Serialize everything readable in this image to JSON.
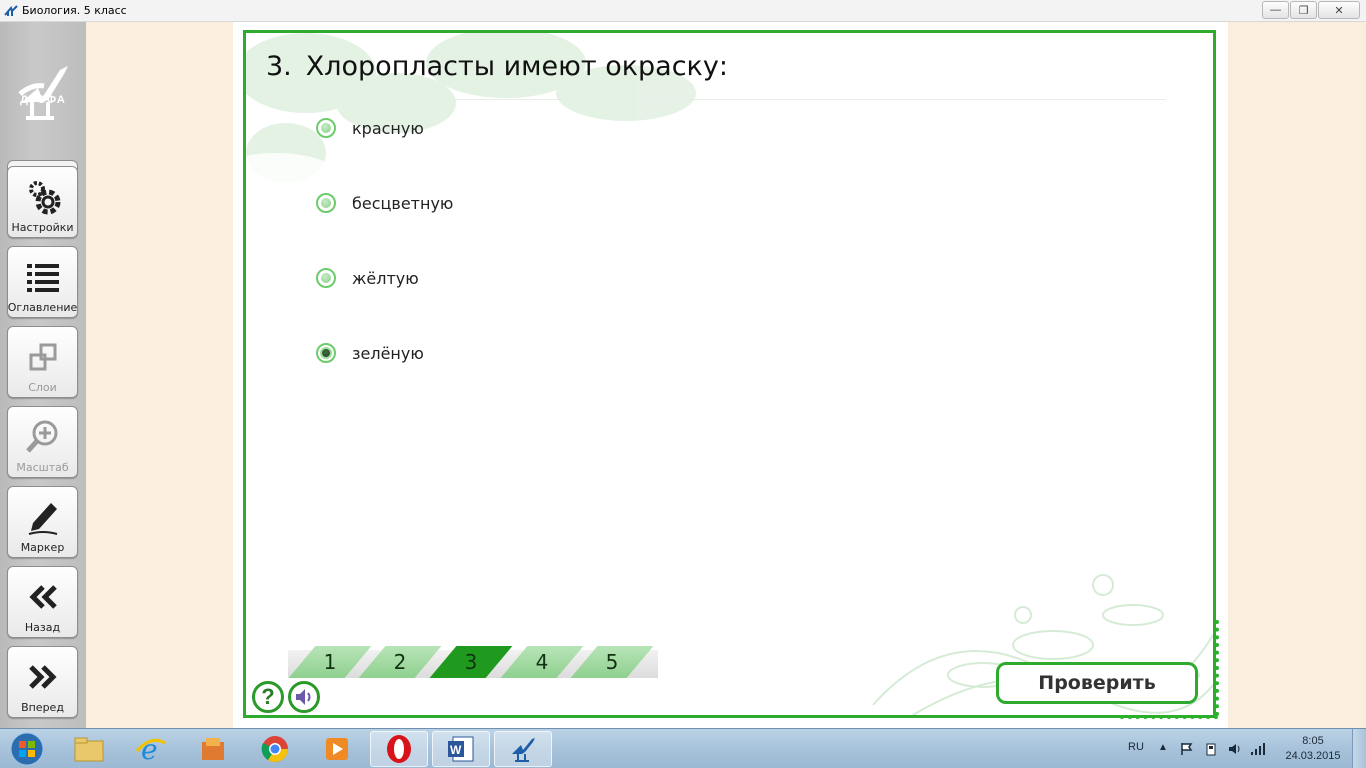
{
  "window": {
    "title": "Биология. 5 класс",
    "controls": [
      "minimize",
      "restore",
      "close"
    ]
  },
  "sidebar": {
    "logo_text": "ДРОФА",
    "buttons": [
      {
        "label": "Настройки",
        "icon": "gear-icon",
        "enabled": true
      },
      {
        "label": "Оглавление",
        "icon": "list-icon",
        "enabled": true
      },
      {
        "label": "Слои",
        "icon": "layers-icon",
        "enabled": false
      },
      {
        "label": "Масштаб",
        "icon": "zoom-icon",
        "enabled": false
      },
      {
        "label": "Маркер",
        "icon": "marker-icon",
        "enabled": true
      },
      {
        "label": "Назад",
        "icon": "double-chevron-left-icon",
        "enabled": true
      },
      {
        "label": "Вперед",
        "icon": "double-chevron-right-icon",
        "enabled": true
      }
    ]
  },
  "quiz": {
    "number": "3.",
    "question": "Хлоропласты имеют окраску:",
    "options": [
      {
        "label": "красную",
        "selected": false
      },
      {
        "label": "бесцветную",
        "selected": false
      },
      {
        "label": "жёлтую",
        "selected": false
      },
      {
        "label": "зелёную",
        "selected": true
      }
    ],
    "steps": [
      "1",
      "2",
      "3",
      "4",
      "5"
    ],
    "active_step": "3",
    "help_symbol": "?",
    "check_label": "Проверить",
    "accent_color": "#2eaa2e"
  },
  "taskbar": {
    "apps": [
      "file-explorer-icon",
      "internet-explorer-icon",
      "app-icon",
      "chrome-icon",
      "media-player-icon",
      "opera-icon",
      "word-icon",
      "drofa-app-icon"
    ],
    "language": "RU",
    "time": "8:05",
    "date": "24.03.2015"
  }
}
